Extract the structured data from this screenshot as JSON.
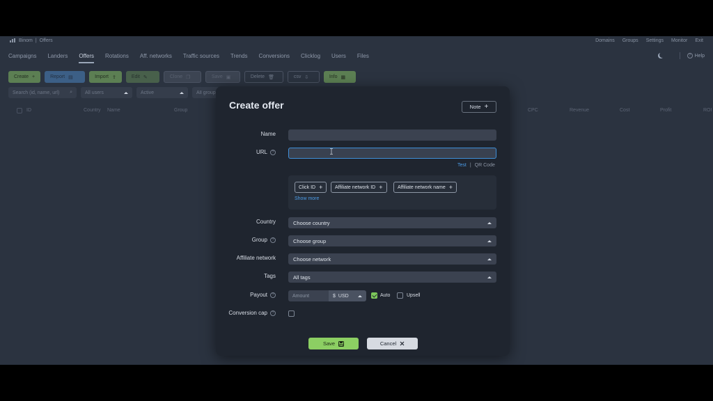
{
  "topbar": {
    "brand": "Binom",
    "section": "Offers",
    "links": [
      "Domains",
      "Groups",
      "Settings",
      "Monitor",
      "Exit"
    ]
  },
  "nav": {
    "tabs": [
      "Campaigns",
      "Landers",
      "Offers",
      "Rotations",
      "Aff. networks",
      "Traffic sources",
      "Trends",
      "Conversions",
      "Clicklog",
      "Users",
      "Files"
    ],
    "active": "Offers",
    "help": "Help"
  },
  "toolbar": {
    "create": "Create",
    "report": "Report",
    "import": "Import",
    "edit": "Edit",
    "clone": "Clone",
    "save": "Save",
    "delete": "Delete",
    "csv": "csv",
    "info": "Info"
  },
  "filters": {
    "search_placeholder": "Search (id, name, url)",
    "users": "All users",
    "status": "Active",
    "groups": "All groups"
  },
  "table": {
    "columns": [
      "ID",
      "Country",
      "Name",
      "Group",
      "CPC",
      "Revenue",
      "Cost",
      "Profit",
      "ROI"
    ]
  },
  "modal": {
    "title": "Create offer",
    "note_button": "Note",
    "labels": {
      "name": "Name",
      "url": "URL",
      "country": "Country",
      "group": "Group",
      "affiliate_network": "Affiliate network",
      "tags": "Tags",
      "payout": "Payout",
      "conversion_cap": "Conversion cap"
    },
    "name_value": "",
    "url_value": "",
    "links": {
      "test": "Test",
      "separator": "|",
      "qr": "QR Code"
    },
    "tokens": [
      "Click ID",
      "Affiliate network ID",
      "Affiliate network name"
    ],
    "show_more": "Show more",
    "selects": {
      "country": "Choose country",
      "group": "Choose group",
      "network": "Choose network",
      "tags": "All tags"
    },
    "payout": {
      "amount_placeholder": "Amount",
      "currency_symbol": "$",
      "currency": "USD",
      "auto_label": "Auto",
      "auto_checked": true,
      "upsell_label": "Upsell",
      "upsell_checked": false
    },
    "conversion_cap_checked": false,
    "save_label": "Save",
    "cancel_label": "Cancel"
  }
}
